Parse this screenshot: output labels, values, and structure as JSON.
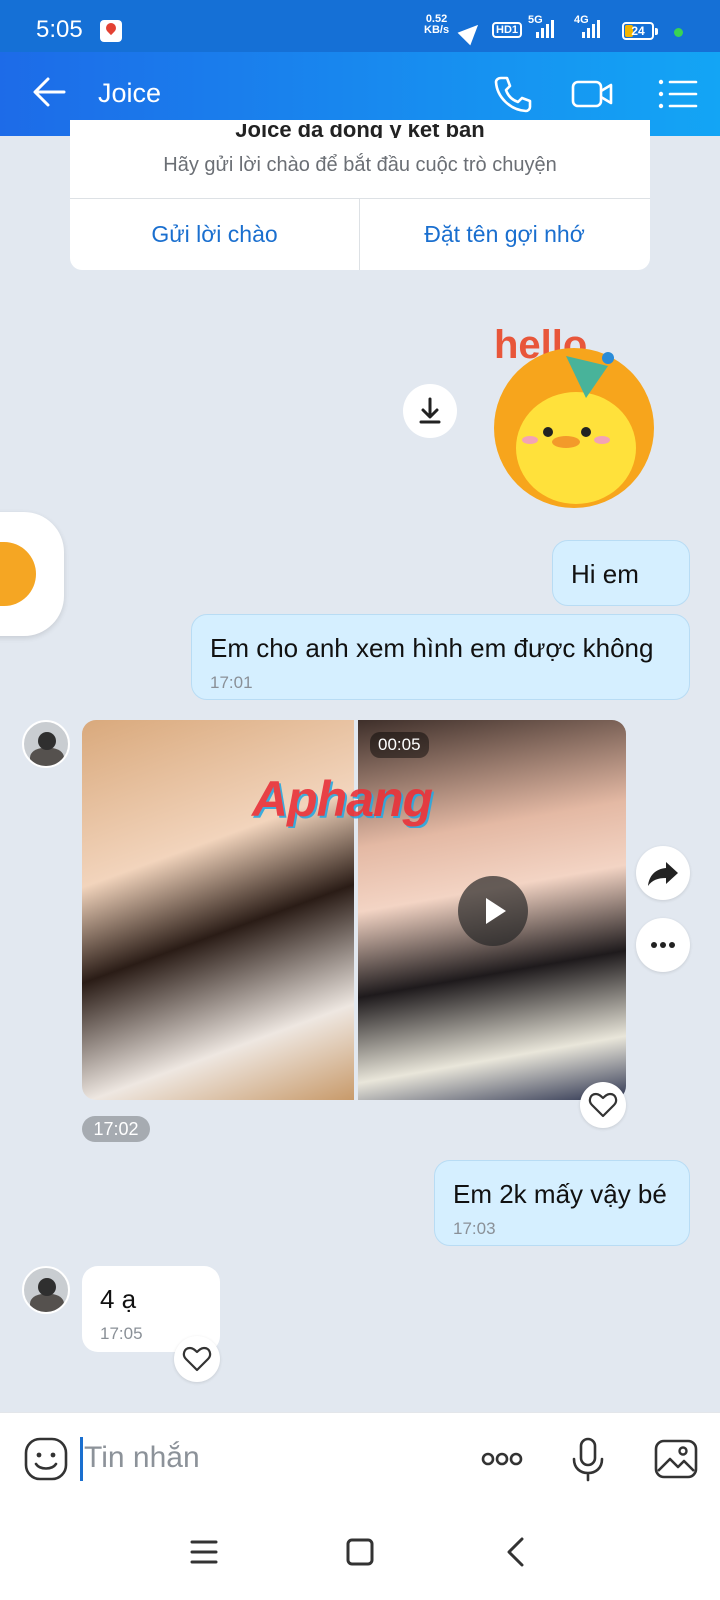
{
  "status_bar": {
    "time": "5:05",
    "net_speed_value": "0.52",
    "net_speed_unit": "KB/s",
    "hd_label": "HD1",
    "signal1": "5G",
    "signal2": "4G",
    "battery": "24"
  },
  "header": {
    "title": "Joice",
    "icons": [
      "back-arrow-icon",
      "phone-icon",
      "video-call-icon",
      "menu-list-icon"
    ]
  },
  "friend_card": {
    "title": "Joice đã đồng ý kết bạn",
    "subtitle": "Hãy gửi lời chào để bắt đầu cuộc trò chuyện",
    "button_greet": "Gửi lời chào",
    "button_nickname": "Đặt tên gợi nhớ"
  },
  "sticker": {
    "text": "hello"
  },
  "messages": [
    {
      "from": "me",
      "text": "Hi em",
      "time": ""
    },
    {
      "from": "me",
      "text": "Em cho anh xem hình em được không",
      "time": "17:01"
    },
    {
      "from": "them",
      "media_duration": "00:05",
      "watermark": "Aphang",
      "time": "17:02"
    },
    {
      "from": "me",
      "text": "Em 2k mấy vậy bé",
      "time": "17:03"
    },
    {
      "from": "them",
      "text": "4 ạ",
      "time": "17:05"
    }
  ],
  "input": {
    "placeholder": "Tin nhắn"
  },
  "colors": {
    "header_start": "#1d6be8",
    "header_end": "#13a5f5",
    "my_bubble": "#d5efff",
    "accent": "#1a6fcf"
  }
}
